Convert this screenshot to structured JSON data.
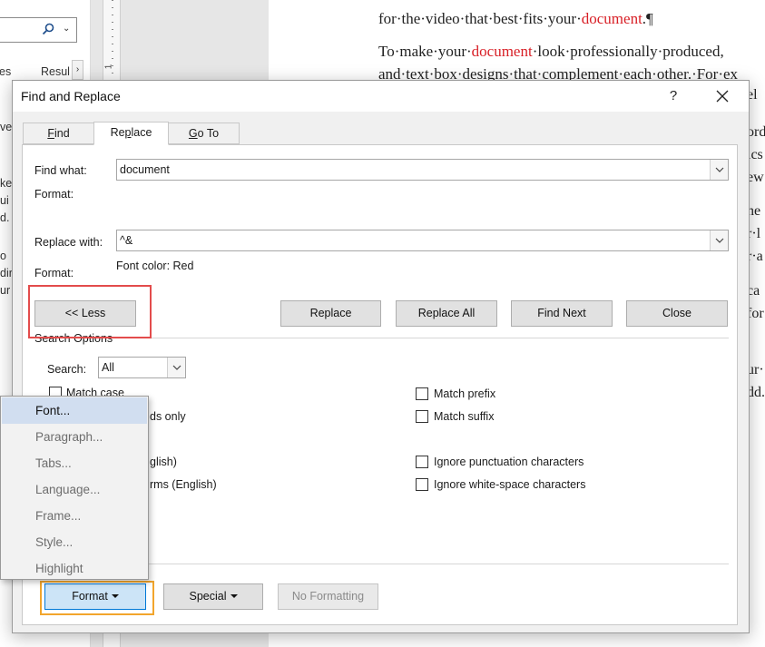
{
  "background": {
    "nav_tabs": [
      "es",
      "Resul"
    ],
    "nav_peek_lines": [
      "ve",
      "kee",
      "ui",
      "d.",
      "o",
      "dir",
      "ur"
    ],
    "ruler_number": "1",
    "doc_lines": [
      {
        "parts": [
          "for·the·video·that·best·fits·your·",
          "document",
          ".¶"
        ]
      },
      {
        "parts": [
          "To·make·your·",
          "document",
          "·look·professionally·produced,"
        ]
      },
      {
        "parts": [
          "and·text·box·designs·that·complement·each·other.·For·ex"
        ]
      }
    ],
    "right_peek_lines": [
      "el",
      "ord",
      "ics",
      "ew",
      "he",
      "r·l",
      "r·a",
      "ca",
      "for",
      "ur·",
      "dd."
    ]
  },
  "dialog": {
    "title": "Find and Replace",
    "help_label": "?",
    "tabs": [
      "Find",
      "Replace",
      "Go To"
    ],
    "active_tab": "Replace",
    "find_what_label": "Find what:",
    "find_value": "document",
    "find_format_label": "Format:",
    "replace_with_label": "Replace with:",
    "replace_value": "^&",
    "replace_format_label": "Format:",
    "replace_format_value": "Font color: Red",
    "buttons": {
      "less": "<< Less",
      "replace": "Replace",
      "replace_all": "Replace All",
      "find_next": "Find Next",
      "close": "Close"
    },
    "search_options_title": "Search Options",
    "search_label": "Search:",
    "search_value": "All",
    "options_left_partial": [
      {
        "label": "Match case",
        "checked": false
      },
      {
        "label": "ds only",
        "checked": false
      },
      {
        "label": "glish)",
        "checked": false
      },
      {
        "label": "rms (English)",
        "checked": false
      }
    ],
    "options_right": [
      {
        "label": "Match prefix",
        "checked": false
      },
      {
        "label": "Match suffix",
        "checked": false
      },
      {
        "label": "Ignore punctuation characters",
        "checked": false
      },
      {
        "label": "Ignore white-space characters",
        "checked": false
      }
    ],
    "bottom_buttons": {
      "format": "Format",
      "special": "Special",
      "no_formatting": "No Formatting"
    }
  },
  "format_menu": {
    "items": [
      "Font...",
      "Paragraph...",
      "Tabs...",
      "Language...",
      "Frame...",
      "Style...",
      "Highlight"
    ],
    "active_index": 0
  },
  "colors": {
    "accent": "#0078d7",
    "highlight_red": "#e34c4c",
    "highlight_orange": "#f2a52c",
    "doc_red": "#d81f26"
  }
}
